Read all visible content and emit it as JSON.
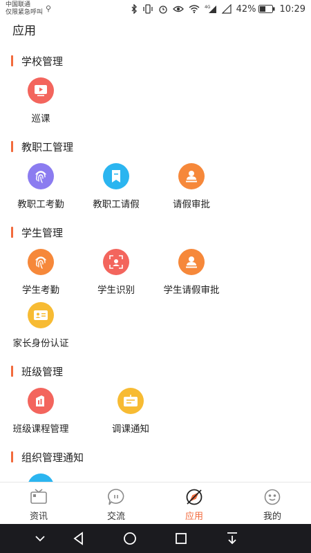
{
  "status_bar": {
    "carrier_line1": "中国联通",
    "carrier_line2": "仅限紧急呼叫",
    "battery": "42%",
    "time": "10:29",
    "icons": [
      "usb-icon",
      "bluetooth-icon",
      "vibrate-icon",
      "alarm-icon",
      "eye-icon",
      "wifi-icon",
      "signal-4g-icon",
      "signal-icon",
      "battery-icon"
    ]
  },
  "header": {
    "title": "应用"
  },
  "sections": [
    {
      "title": "学校管理",
      "apps": [
        {
          "label": "巡课",
          "icon": "video-icon",
          "color": "#f3655d"
        }
      ]
    },
    {
      "title": "教职工管理",
      "apps": [
        {
          "label": "教职工考勤",
          "icon": "fingerprint-icon",
          "color": "#8b7cf0"
        },
        {
          "label": "教职工请假",
          "icon": "bookmark-icon",
          "color": "#2bb5f0"
        },
        {
          "label": "请假审批",
          "icon": "user-stamp-icon",
          "color": "#f6883a"
        }
      ]
    },
    {
      "title": "学生管理",
      "apps": [
        {
          "label": "学生考勤",
          "icon": "fingerprint-icon",
          "color": "#f6883a"
        },
        {
          "label": "学生识别",
          "icon": "face-scan-icon",
          "color": "#f3655d"
        },
        {
          "label": "学生请假审批",
          "icon": "user-stamp-icon",
          "color": "#f6883a"
        },
        {
          "label": "家长身份认证",
          "icon": "id-card-icon",
          "color": "#f7bb33"
        }
      ]
    },
    {
      "title": "班级管理",
      "apps": [
        {
          "label": "班级课程管理",
          "icon": "book-icon",
          "color": "#f3655d"
        },
        {
          "label": "调课通知",
          "icon": "notice-board-icon",
          "color": "#f7bb33"
        }
      ]
    },
    {
      "title": "组织管理通知",
      "apps": [
        {
          "label": "",
          "icon": "partial-app-icon",
          "color": "#2bb5f0"
        }
      ]
    }
  ],
  "tabs": [
    {
      "label": "资讯",
      "icon": "tv-icon",
      "active": false
    },
    {
      "label": "交流",
      "icon": "chat-bubble-icon",
      "active": false
    },
    {
      "label": "应用",
      "icon": "compass-icon",
      "active": true
    },
    {
      "label": "我的",
      "icon": "smiley-icon",
      "active": false
    }
  ],
  "colors": {
    "accent": "#f26a3c",
    "nav_bg": "#1b1b1f"
  }
}
